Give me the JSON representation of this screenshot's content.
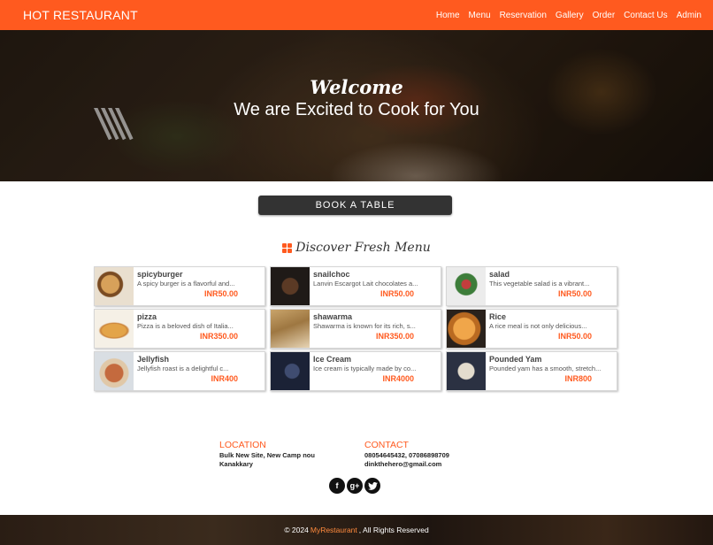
{
  "navbar": {
    "brand": "HOT RESTAURANT",
    "links": [
      "Home",
      "Menu",
      "Reservation",
      "Gallery",
      "Order",
      "Contact Us",
      "Admin"
    ]
  },
  "hero": {
    "welcome": "Welcome",
    "tagline": "We are Excited to Cook for You"
  },
  "book_button": "BOOK A TABLE",
  "menu": {
    "title": "Discover Fresh Menu",
    "items": [
      {
        "name": "spicyburger",
        "desc": "A spicy burger is a flavorful and...",
        "price": "INR50.00"
      },
      {
        "name": "snailchoc",
        "desc": "Lanvin Escargot Lait chocolates a...",
        "price": "INR50.00"
      },
      {
        "name": "salad",
        "desc": "This vegetable salad is a vibrant...",
        "price": "INR50.00"
      },
      {
        "name": "pizza",
        "desc": "Pizza is a beloved dish of Italia...",
        "price": "INR350.00"
      },
      {
        "name": "shawarma",
        "desc": "Shawarma is known for its rich, s...",
        "price": "INR350.00"
      },
      {
        "name": "Rice",
        "desc": "A rice meal is not only delicious...",
        "price": "INR50.00"
      },
      {
        "name": "Jellyfish",
        "desc": "Jellyfish roast is a delightful c...",
        "price": "INR400"
      },
      {
        "name": "Ice Cream",
        "desc": "Ice cream is typically made by co...",
        "price": "INR4000"
      },
      {
        "name": "Pounded Yam",
        "desc": "Pounded yam has a smooth, stretch...",
        "price": "INR800"
      }
    ]
  },
  "location": {
    "title": "LOCATION",
    "line1": "Bulk New Site, New Camp nou",
    "line2": "Kanakkary"
  },
  "contact": {
    "title": "CONTACT",
    "phones": "08054645432, 07086898709",
    "email": "dinkthehero@gmail.com"
  },
  "social": [
    "facebook-icon",
    "google-plus-icon",
    "twitter-icon"
  ],
  "footer": {
    "prefix": "© 2024",
    "brand": "MyRestaurant",
    "suffix": ", All Rights Reserved"
  },
  "colors": {
    "accent": "#ff5a1f",
    "button": "#333333"
  }
}
